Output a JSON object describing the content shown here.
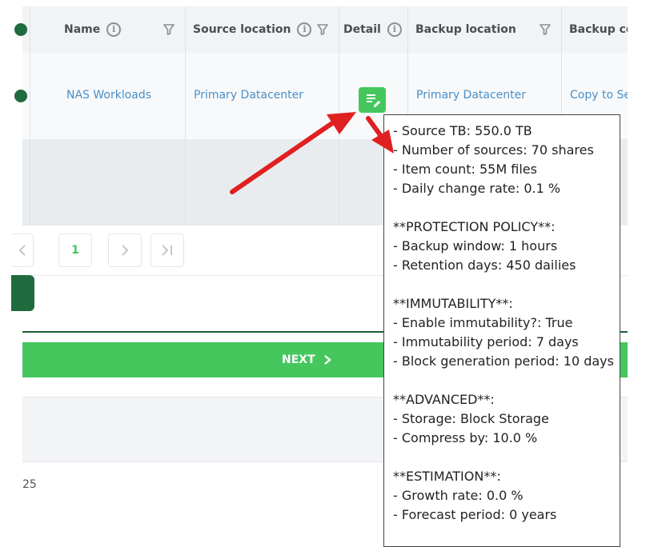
{
  "table": {
    "headers": {
      "name": "Name",
      "source_location": "Source location",
      "detail": "Detail",
      "backup_location": "Backup location",
      "backup_copy": "Backup copy"
    },
    "row": {
      "name": "NAS Workloads",
      "source_location": "Primary Datacenter",
      "backup_location": "Primary Datacenter",
      "backup_copy": "Copy to Secondary"
    }
  },
  "pagination": {
    "current_page": "1",
    "prev_icon": "chevron-left-icon",
    "next_icon": "chevron-right-icon",
    "last_icon": "last-page-icon"
  },
  "footer": {
    "next_label": "NEXT",
    "year_fragment": "25"
  },
  "tooltip": {
    "lines": [
      "- Source TB: 550.0 TB",
      "- Number of sources: 70 shares",
      "- Item count: 55M files",
      "- Daily change rate: 0.1 %",
      "",
      "**PROTECTION POLICY**:",
      "- Backup window: 1 hours",
      "- Retention days: 450 dailies",
      "",
      "**IMMUTABILITY**:",
      "- Enable immutability?: True",
      "- Immutability period: 7 days",
      "- Block generation period: 10 days",
      "",
      "**ADVANCED**:",
      "- Storage: Block Storage",
      "- Compress by: 10.0 %",
      "",
      "**ESTIMATION**:",
      "- Growth rate: 0.0 %",
      "- Forecast period: 0 years"
    ]
  },
  "colors": {
    "accent_green": "#45c75e",
    "dark_green": "#1f6b3d",
    "link_blue": "#4a8fc7",
    "annotation_red": "#e02020"
  }
}
